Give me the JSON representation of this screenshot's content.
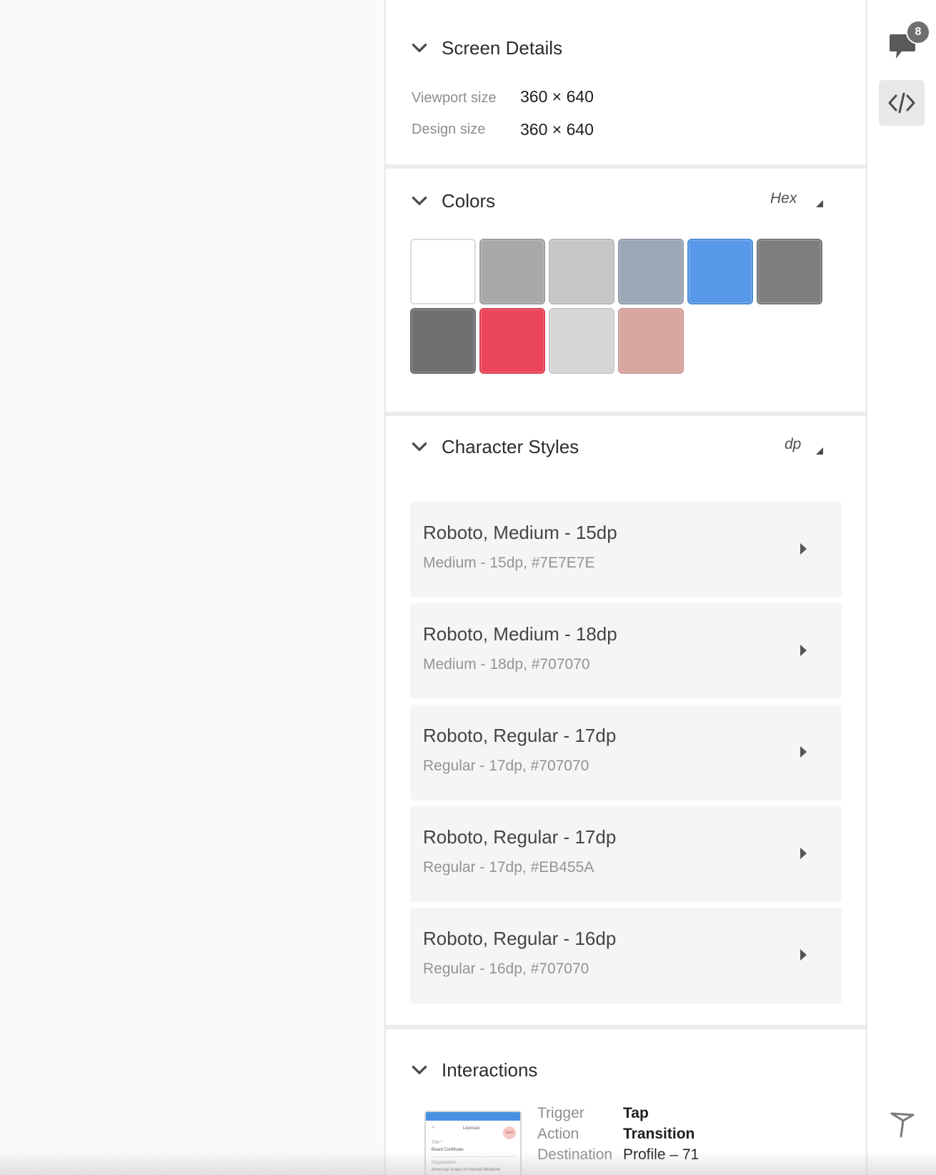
{
  "screen_details": {
    "title": "Screen Details",
    "viewport_label": "Viewport size",
    "viewport_value": "360 × 640",
    "design_label": "Design size",
    "design_value": "360 × 640"
  },
  "colors": {
    "title": "Colors",
    "format_label": "Hex",
    "swatches": [
      "#ffffff",
      "#a9a9a9",
      "#c6c6c6",
      "#9ca7b6",
      "#5899ea",
      "#7e7e7e",
      "#707070",
      "#eb455a",
      "#d6d6d6",
      "#d9a59f"
    ]
  },
  "character_styles": {
    "title": "Character Styles",
    "unit_label": "dp",
    "items": [
      {
        "title": "Roboto, Medium - 15dp",
        "subtitle": "Medium - 15dp, #7E7E7E"
      },
      {
        "title": "Roboto, Medium - 18dp",
        "subtitle": "Medium - 18dp, #707070"
      },
      {
        "title": "Roboto, Regular - 17dp",
        "subtitle": "Regular - 17dp, #707070"
      },
      {
        "title": "Roboto, Regular - 17dp",
        "subtitle": "Regular - 17dp, #EB455A"
      },
      {
        "title": "Roboto, Regular - 16dp",
        "subtitle": "Regular - 16dp, #707070"
      }
    ]
  },
  "interactions": {
    "title": "Interactions",
    "trigger_label": "Trigger",
    "trigger_value": "Tap",
    "action_label": "Action",
    "action_value": "Transition",
    "destination_label": "Destination",
    "destination_value": "Profile – 71",
    "thumbnail": {
      "header_title": "Licenses",
      "save_label": "Save",
      "field_label": "Title *",
      "field_value": "Board Certificate",
      "org_label": "Organization",
      "org_value": "American board of Internal Medicine"
    }
  },
  "rail": {
    "comment_count": "8",
    "icons": [
      "comment-icon",
      "code-icon",
      "flag-icon"
    ]
  }
}
